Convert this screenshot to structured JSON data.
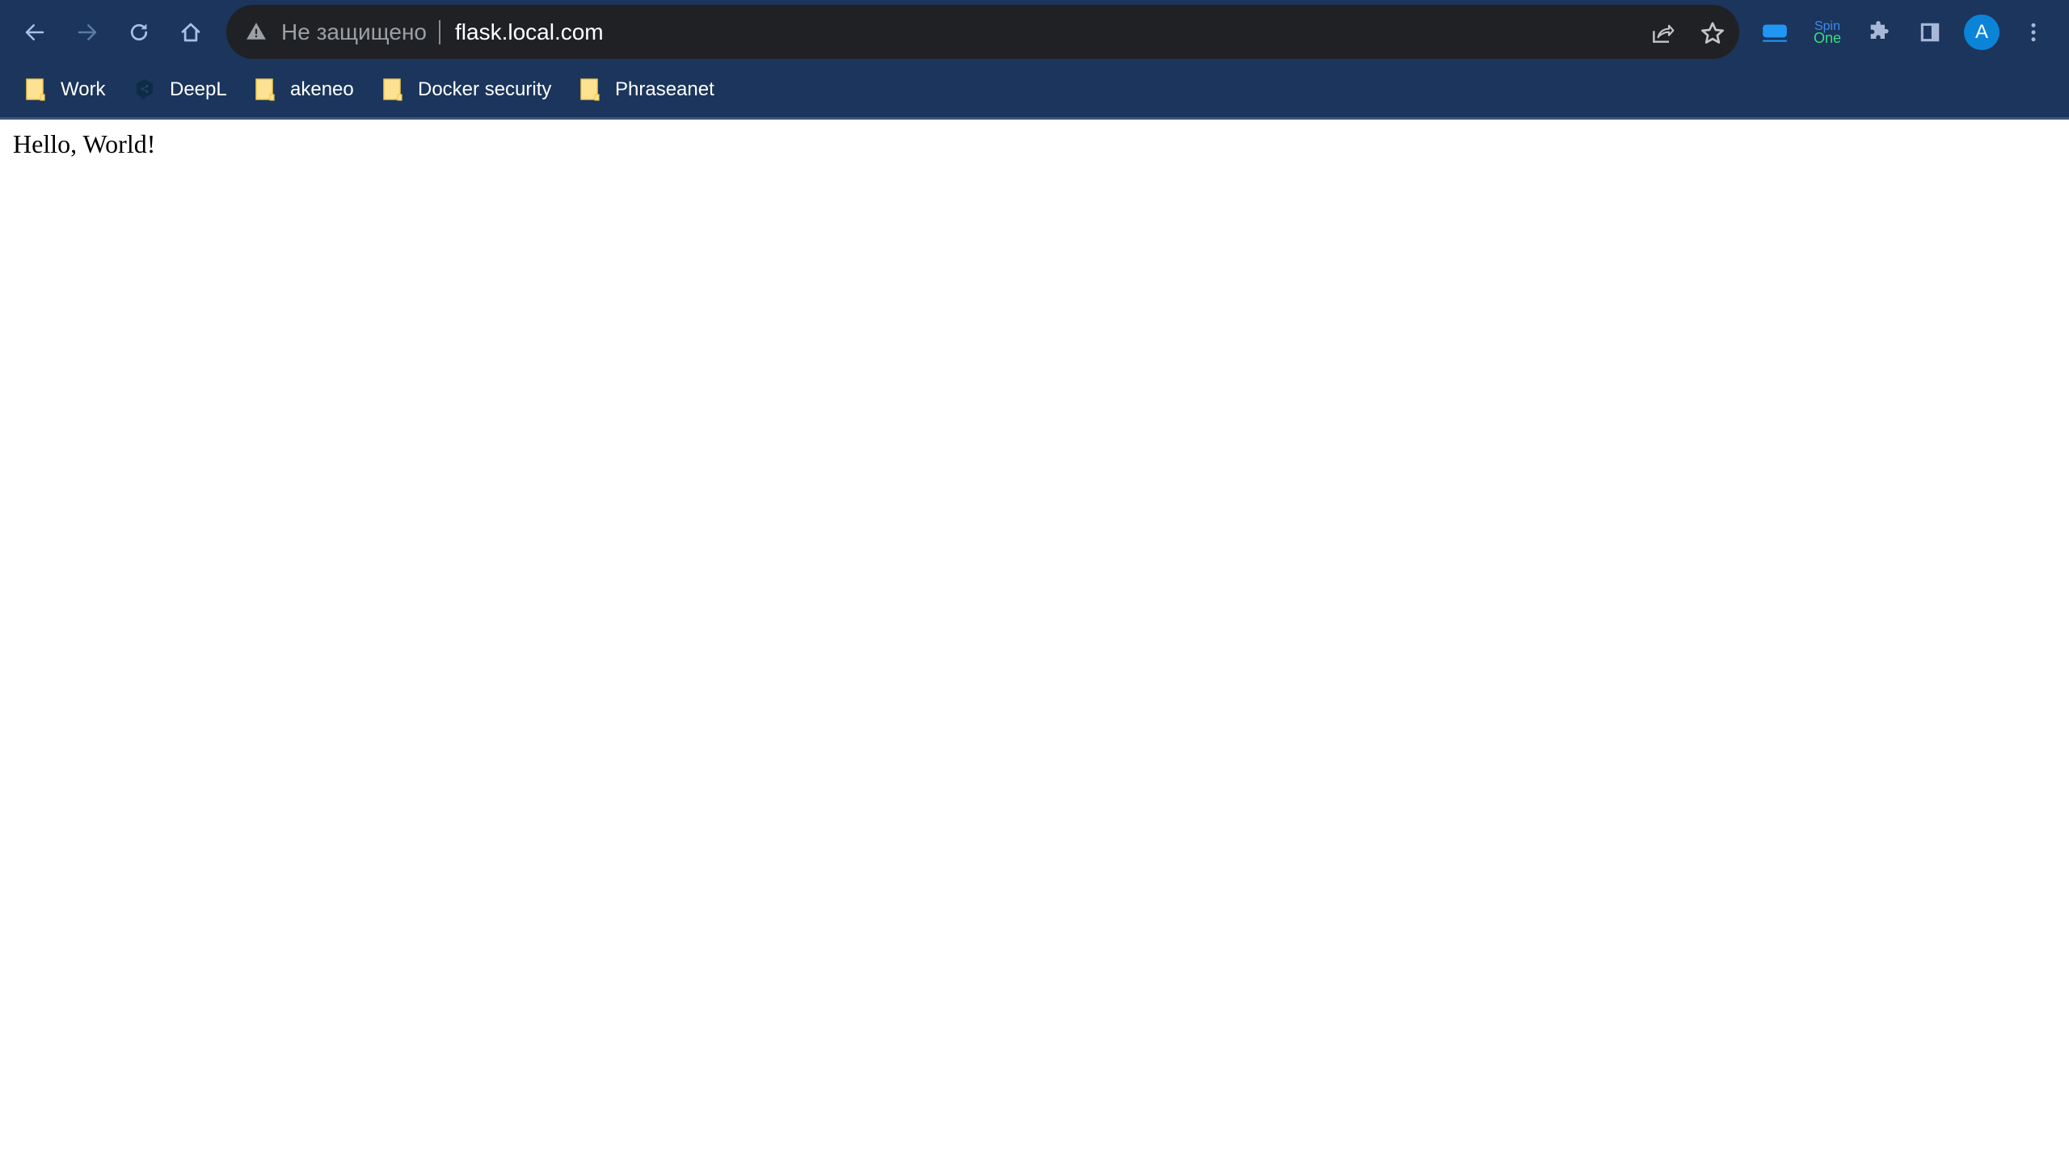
{
  "browser": {
    "nav": {
      "back": "back-arrow",
      "forward": "forward-arrow",
      "reload": "reload",
      "home": "home"
    },
    "omnibox": {
      "security_icon": "warning-triangle",
      "security_label": "Не защищено",
      "url": "flask.local.com",
      "share_icon": "share",
      "bookmark_icon": "star"
    },
    "extensions": {
      "cast_icon": "screen-cast",
      "spin_one_line1": "Spin",
      "spin_one_line2": "One",
      "puzzle_icon": "extensions",
      "side_panel_icon": "side-panel"
    },
    "profile": {
      "avatar_letter": "A",
      "avatar_color": "#0b84d8"
    },
    "menu_icon": "vertical-dots",
    "colors": {
      "toolbar": "#1b355c",
      "omnibox": "#202124",
      "folder": "#fde293"
    }
  },
  "bookmarks": [
    {
      "label": "Work",
      "icon": "folder"
    },
    {
      "label": "DeepL",
      "icon": "deepl"
    },
    {
      "label": "akeneo",
      "icon": "folder"
    },
    {
      "label": "Docker security",
      "icon": "folder"
    },
    {
      "label": "Phraseanet",
      "icon": "folder"
    }
  ],
  "page": {
    "text": "Hello, World!"
  }
}
